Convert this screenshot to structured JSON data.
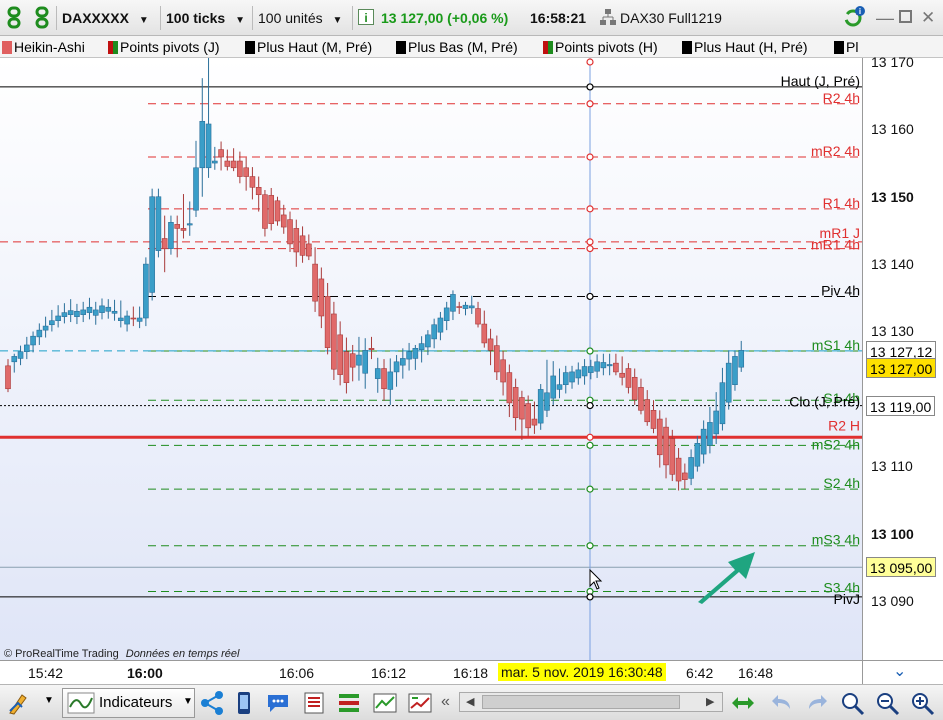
{
  "toolbar": {
    "symbol": "DAXXXXX",
    "interval": "100 ticks",
    "units": "100 unités",
    "price_change": "13 127,00 (+0,06 %)",
    "time": "16:58:21",
    "instrument": "DAX30 Full1219",
    "colors": {
      "price_change": "#1a9a1a",
      "accent": "#1a5fb4"
    }
  },
  "indicators": [
    {
      "label": "Heikin-Ashi",
      "color": "#e06060"
    },
    {
      "label": "Points pivots (J)",
      "color": "#c01010"
    },
    {
      "label": "Plus Haut (M, Pré)",
      "color": "#000000"
    },
    {
      "label": "Plus Bas (M, Pré)",
      "color": "#000000"
    },
    {
      "label": "Points pivots (H)",
      "color": "#c01010"
    },
    {
      "label": "Plus Haut (H, Pré)",
      "color": "#000000"
    },
    {
      "label": "Pl",
      "color": "#000000"
    }
  ],
  "axis": {
    "ticks": [
      {
        "label": "13 170",
        "bold": false,
        "value": 13170
      },
      {
        "label": "13 160",
        "bold": false,
        "value": 13160
      },
      {
        "label": "13 150",
        "bold": true,
        "value": 13150
      },
      {
        "label": "13 140",
        "bold": false,
        "value": 13140
      },
      {
        "label": "13 130",
        "bold": false,
        "value": 13130
      },
      {
        "label": "13 110",
        "bold": false,
        "value": 13110
      },
      {
        "label": "13 100",
        "bold": true,
        "value": 13100
      },
      {
        "label": "13 090",
        "bold": false,
        "value": 13090
      }
    ],
    "price_boxes": [
      {
        "label": "13 127,12",
        "value": 13127.12,
        "bg": "#ffffff",
        "fg": "#000000"
      },
      {
        "label": "13 127,00",
        "value": 13124.6,
        "bg": "#ffe000",
        "fg": "#000000"
      },
      {
        "label": "13 119,00",
        "value": 13119,
        "bg": "#ffffff",
        "fg": "#000000"
      },
      {
        "label": "13 095,00",
        "value": 13095,
        "bg": "#ffff99",
        "fg": "#000000"
      }
    ]
  },
  "levels": [
    {
      "label": "Haut (J, Pré)",
      "value": 13166.3,
      "color": "#000000",
      "style": "solid"
    },
    {
      "label": "R2 4h",
      "value": 13163.8,
      "color": "#e03030",
      "style": "dash"
    },
    {
      "label": "mR2 4h",
      "value": 13155.9,
      "color": "#e03030",
      "style": "dash"
    },
    {
      "label": "R1 4h",
      "value": 13148.2,
      "color": "#e03030",
      "style": "dash"
    },
    {
      "label": "mR1 J",
      "value": 13143.3,
      "color": "#e03030",
      "style": "dash"
    },
    {
      "label": "mR1 4h",
      "value": 13142.3,
      "color": "#e03030",
      "style": "dash"
    },
    {
      "label": "Piv 4h",
      "value": 13135.2,
      "color": "#000000",
      "style": "dash"
    },
    {
      "label": "mS1 4h",
      "value": 13127.1,
      "color": "#1e8c1e",
      "style": "dash"
    },
    {
      "label": "S1 4h",
      "value": 13119.8,
      "color": "#1e8c1e",
      "style": "dash"
    },
    {
      "label": "Clo (J, Pré)",
      "value": 13119.0,
      "color": "#000000",
      "style": "dot"
    },
    {
      "label": "R2 H",
      "value": 13114.3,
      "color": "#e03030",
      "style": "solid"
    },
    {
      "label": "mS2 4h",
      "value": 13113.1,
      "color": "#1e8c1e",
      "style": "dash"
    },
    {
      "label": "S2 4h",
      "value": 13106.6,
      "color": "#1e8c1e",
      "style": "dash"
    },
    {
      "label": "mS3 4h",
      "value": 13098.2,
      "color": "#1e8c1e",
      "style": "dash"
    },
    {
      "label": "S3 4h",
      "value": 13091.4,
      "color": "#1e8c1e",
      "style": "dash"
    },
    {
      "label": "PivJ",
      "value": 13090.6,
      "color": "#000000",
      "style": "solid"
    }
  ],
  "timeaxis": {
    "labels": [
      "15:42",
      "16:00",
      "16:06",
      "16:12",
      "16:18",
      "6:42",
      "16:48"
    ],
    "cursor_label": "mar. 5 nov. 2019 16:30:48"
  },
  "watermark": {
    "brand": "© ProRealTime Trading",
    "realtime": "Données en temps réel"
  },
  "bottom": {
    "indicators_label": "Indicateurs"
  },
  "chart_data": {
    "type": "candlestick",
    "ylim": [
      13078,
      13172
    ],
    "candles": [
      [
        13124.9,
        13125.9,
        13121.0,
        13121.5
      ],
      [
        13125.5,
        13126.7,
        13123.9,
        13126.3
      ],
      [
        13126.0,
        13127.9,
        13125.0,
        13127.0
      ],
      [
        13127.0,
        13129.2,
        13125.9,
        13128.0
      ],
      [
        13128.0,
        13130.0,
        13126.9,
        13129.3
      ],
      [
        13129.2,
        13131.2,
        13128.0,
        13130.2
      ],
      [
        13130.2,
        13132.2,
        13129.1,
        13130.8
      ],
      [
        13131.0,
        13133.2,
        13130.0,
        13131.6
      ],
      [
        13131.6,
        13133.9,
        13130.6,
        13132.3
      ],
      [
        13132.2,
        13134.2,
        13131.2,
        13132.8
      ],
      [
        13132.5,
        13134.8,
        13131.4,
        13133.1
      ],
      [
        13132.2,
        13134.1,
        13131.1,
        13133.0
      ],
      [
        13132.5,
        13134.4,
        13131.4,
        13133.2
      ],
      [
        13132.8,
        13135.0,
        13131.8,
        13133.6
      ],
      [
        13132.4,
        13134.4,
        13131.0,
        13133.2
      ],
      [
        13132.8,
        13134.9,
        13131.8,
        13133.8
      ],
      [
        13133.0,
        13134.8,
        13131.9,
        13133.6
      ],
      [
        13132.7,
        13134.7,
        13131.6,
        13133.0
      ],
      [
        13131.6,
        13134.6,
        13130.6,
        13132.0
      ],
      [
        13131.1,
        13133.1,
        13130.0,
        13132.3
      ],
      [
        13132.0,
        13133.7,
        13130.8,
        13131.9
      ],
      [
        13131.5,
        13133.7,
        13130.5,
        13132.0
      ],
      [
        13132.0,
        13141.0,
        13130.8,
        13140.0
      ],
      [
        13135.8,
        13151.2,
        13134.6,
        13150.0
      ],
      [
        13142.0,
        13151.2,
        13141.0,
        13150.0
      ],
      [
        13143.8,
        13147.2,
        13138.8,
        13142.3
      ],
      [
        13142.3,
        13147.2,
        13141.4,
        13146.2
      ],
      [
        13145.9,
        13147.2,
        13141.0,
        13145.3
      ],
      [
        13145.3,
        13150.4,
        13143.8,
        13145.0
      ],
      [
        13145.8,
        13149.3,
        13144.2,
        13146.0
      ],
      [
        13148.0,
        13158.3,
        13147.0,
        13154.3
      ],
      [
        13154.3,
        13167.6,
        13150.0,
        13161.2
      ],
      [
        13154.3,
        13171.5,
        13152.8,
        13160.8
      ],
      [
        13155.0,
        13157.4,
        13154.0,
        13155.3
      ],
      [
        13157.0,
        13158.2,
        13153.9,
        13155.9
      ],
      [
        13155.3,
        13157.0,
        13153.9,
        13154.5
      ],
      [
        13155.3,
        13157.2,
        13153.8,
        13154.3
      ],
      [
        13155.3,
        13156.7,
        13152.0,
        13153.0
      ],
      [
        13154.3,
        13155.8,
        13150.9,
        13153.0
      ],
      [
        13153.0,
        13154.4,
        13149.6,
        13151.4
      ],
      [
        13151.4,
        13153.0,
        13147.8,
        13150.3
      ],
      [
        13150.3,
        13151.0,
        13144.1,
        13145.3
      ],
      [
        13150.2,
        13151.3,
        13145.0,
        13146.0
      ],
      [
        13149.4,
        13150.0,
        13145.7,
        13146.4
      ],
      [
        13147.3,
        13148.8,
        13144.5,
        13145.5
      ],
      [
        13146.6,
        13147.8,
        13141.8,
        13143.0
      ],
      [
        13145.3,
        13146.6,
        13139.6,
        13141.8
      ],
      [
        13144.2,
        13145.6,
        13140.2,
        13141.3
      ],
      [
        13143.0,
        13144.4,
        13140.6,
        13141.2
      ],
      [
        13140.0,
        13142.5,
        13132.9,
        13134.5
      ],
      [
        13137.8,
        13139.5,
        13130.5,
        13132.3
      ],
      [
        13135.2,
        13137.2,
        13126.6,
        13127.6
      ],
      [
        13132.6,
        13134.4,
        13122.8,
        13124.4
      ],
      [
        13129.5,
        13131.5,
        13122.0,
        13123.6
      ],
      [
        13127.0,
        13129.1,
        13120.8,
        13122.4
      ],
      [
        13126.7,
        13128.0,
        13122.6,
        13124.7
      ],
      [
        13125.0,
        13129.2,
        13122.7,
        13126.5
      ],
      [
        13123.8,
        13129.0,
        13121.5,
        13127.2
      ],
      [
        13127.5,
        13129.2,
        13125.9,
        13127.3
      ],
      [
        13123.0,
        13126.1,
        13120.9,
        13124.5
      ],
      [
        13124.5,
        13125.9,
        13119.7,
        13121.5
      ],
      [
        13121.4,
        13126.0,
        13119.1,
        13124.0
      ],
      [
        13124.0,
        13126.5,
        13121.8,
        13125.5
      ],
      [
        13125.0,
        13127.5,
        13123.0,
        13126.0
      ],
      [
        13125.9,
        13128.3,
        13124.2,
        13127.0
      ],
      [
        13126.0,
        13128.0,
        13124.3,
        13127.5
      ],
      [
        13127.3,
        13129.3,
        13125.4,
        13128.2
      ],
      [
        13127.7,
        13130.2,
        13126.5,
        13129.5
      ],
      [
        13128.9,
        13131.9,
        13127.5,
        13131.0
      ],
      [
        13129.9,
        13132.9,
        13128.7,
        13132.0
      ],
      [
        13131.6,
        13134.4,
        13130.2,
        13133.5
      ],
      [
        13133.0,
        13136.1,
        13131.7,
        13135.5
      ],
      [
        13133.7,
        13134.4,
        13132.6,
        13133.6
      ],
      [
        13133.4,
        13134.4,
        13132.4,
        13133.9
      ],
      [
        13133.5,
        13135.3,
        13132.6,
        13133.8
      ],
      [
        13133.4,
        13134.4,
        13130.6,
        13131.1
      ],
      [
        13131.1,
        13133.1,
        13127.6,
        13128.3
      ],
      [
        13128.9,
        13130.4,
        13125.0,
        13127.2
      ],
      [
        13127.9,
        13129.4,
        13122.8,
        13124.0
      ],
      [
        13125.8,
        13127.1,
        13120.5,
        13122.5
      ],
      [
        13123.9,
        13125.1,
        13117.3,
        13119.4
      ],
      [
        13121.7,
        13123.0,
        13115.3,
        13117.2
      ],
      [
        13120.2,
        13121.2,
        13113.9,
        13117.0
      ],
      [
        13119.3,
        13120.5,
        13114.4,
        13115.7
      ],
      [
        13117.0,
        13119.6,
        13114.8,
        13116.1
      ],
      [
        13116.4,
        13122.2,
        13115.4,
        13121.4
      ],
      [
        13118.3,
        13125.8,
        13117.3,
        13120.9
      ],
      [
        13120.1,
        13125.6,
        13119.1,
        13123.4
      ],
      [
        13121.4,
        13124.5,
        13120.1,
        13122.1
      ],
      [
        13122.1,
        13124.9,
        13120.8,
        13123.9
      ],
      [
        13122.5,
        13124.9,
        13121.5,
        13124.0
      ],
      [
        13123.1,
        13125.4,
        13122.1,
        13124.3
      ],
      [
        13123.4,
        13125.9,
        13122.1,
        13124.8
      ],
      [
        13123.9,
        13125.8,
        13122.9,
        13124.8
      ],
      [
        13124.1,
        13126.6,
        13123.1,
        13125.5
      ],
      [
        13124.6,
        13126.7,
        13123.5,
        13125.4
      ],
      [
        13124.9,
        13126.7,
        13123.5,
        13125.1
      ],
      [
        13125.3,
        13126.7,
        13123.5,
        13124.0
      ],
      [
        13123.8,
        13126.3,
        13122.0,
        13123.2
      ],
      [
        13124.5,
        13125.3,
        13120.8,
        13121.7
      ],
      [
        13123.2,
        13124.5,
        13119.1,
        13119.9
      ],
      [
        13121.7,
        13123.0,
        13117.7,
        13118.3
      ],
      [
        13119.9,
        13121.3,
        13116.0,
        13116.6
      ],
      [
        13118.3,
        13119.8,
        13114.9,
        13115.6
      ],
      [
        13117.0,
        13118.3,
        13109.8,
        13111.7
      ],
      [
        13115.8,
        13117.2,
        13108.2,
        13110.2
      ],
      [
        13114.1,
        13115.4,
        13107.8,
        13108.8
      ],
      [
        13111.2,
        13112.7,
        13106.4,
        13107.8
      ],
      [
        13109.0,
        13110.4,
        13106.6,
        13108.0
      ],
      [
        13108.2,
        13112.5,
        13107.2,
        13111.3
      ],
      [
        13110.0,
        13114.5,
        13109.2,
        13113.4
      ],
      [
        13111.8,
        13116.8,
        13110.4,
        13115.5
      ],
      [
        13113.1,
        13118.8,
        13111.9,
        13116.5
      ],
      [
        13114.8,
        13121.0,
        13113.3,
        13118.2
      ],
      [
        13116.3,
        13124.6,
        13115.3,
        13122.4
      ],
      [
        13119.5,
        13127.2,
        13118.4,
        13125.3
      ],
      [
        13122.1,
        13127.2,
        13121.2,
        13126.3
      ],
      [
        13124.7,
        13128.6,
        13124.0,
        13127.2
      ]
    ]
  }
}
